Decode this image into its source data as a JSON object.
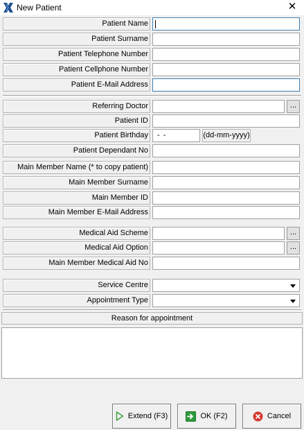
{
  "window": {
    "title": "New Patient"
  },
  "labels": {
    "patient_name": "Patient Name",
    "patient_surname": "Patient Surname",
    "patient_telephone": "Patient Telephone Number",
    "patient_cellphone": "Patient Cellphone Number",
    "patient_email": "Patient E-Mail Address",
    "referring_doctor": "Referring Doctor",
    "patient_id": "Patient ID",
    "patient_birthday": "Patient Birthday",
    "patient_dependant_no": "Patient Dependant No",
    "main_member_name": "Main Member Name (* to copy patient)",
    "main_member_surname": "Main Member Surname",
    "main_member_id": "Main Member ID",
    "main_member_email": "Main Member E-Mail Address",
    "medical_aid_scheme": "Medical Aid Scheme",
    "medical_aid_option": "Medical Aid Option",
    "main_member_medical_aid_no": "Main Member Medical Aid No",
    "service_centre": "Service Centre",
    "appointment_type": "Appointment Type"
  },
  "values": {
    "birthday": "- -",
    "birthday_format": "(dd-mm-yyyy)",
    "browse": "..."
  },
  "reason": {
    "header": "Reason for appointment"
  },
  "buttons": {
    "extend": "Extend (F3)",
    "ok": "OK (F2)",
    "cancel": "Cancel"
  },
  "colors": {
    "focus_border": "#3c7fb1",
    "extend_icon": "#3a9a3a",
    "ok_icon": "#2e9b3e",
    "cancel_icon": "#d33a2f"
  }
}
